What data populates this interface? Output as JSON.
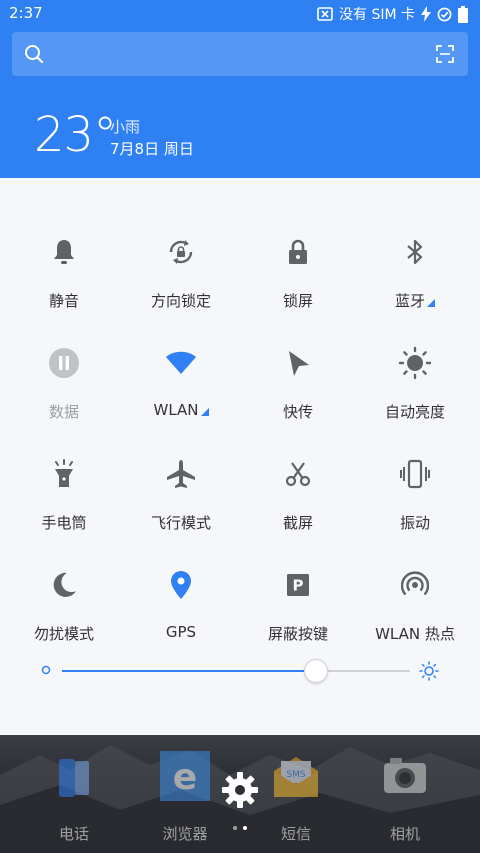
{
  "status": {
    "time": "2:37",
    "carrier_text": "没有 SIM 卡"
  },
  "weather": {
    "temperature": "23°",
    "condition": "小雨",
    "date": "7月8日 周日"
  },
  "toggles": [
    {
      "label": "静音",
      "icon": "bell-icon",
      "active": false
    },
    {
      "label": "方向锁定",
      "icon": "rotation-lock-icon",
      "active": false
    },
    {
      "label": "锁屏",
      "icon": "lock-icon",
      "active": false
    },
    {
      "label": "蓝牙",
      "icon": "bluetooth-icon",
      "active": false
    },
    {
      "label": "数据",
      "icon": "pause-data-icon",
      "active": false,
      "disabled": true
    },
    {
      "label": "WLAN",
      "icon": "wifi-icon",
      "active": true
    },
    {
      "label": "快传",
      "icon": "send-arrow-icon",
      "active": false
    },
    {
      "label": "自动亮度",
      "icon": "brightness-auto-icon",
      "active": false
    },
    {
      "label": "手电筒",
      "icon": "flashlight-icon",
      "active": false
    },
    {
      "label": "飞行模式",
      "icon": "airplane-icon",
      "active": false
    },
    {
      "label": "截屏",
      "icon": "scissors-icon",
      "active": false
    },
    {
      "label": "振动",
      "icon": "vibrate-icon",
      "active": false
    },
    {
      "label": "勿扰模式",
      "icon": "moon-icon",
      "active": false
    },
    {
      "label": "GPS",
      "icon": "location-pin-icon",
      "active": true
    },
    {
      "label": "屏蔽按键",
      "icon": "parking-key-icon",
      "active": false
    },
    {
      "label": "WLAN 热点",
      "icon": "hotspot-icon",
      "active": false
    }
  ],
  "brightness": {
    "level": 0.73
  },
  "dock": {
    "apps": [
      {
        "label": "电话",
        "icon": "phone-app-icon"
      },
      {
        "label": "浏览器",
        "icon": "browser-app-icon"
      },
      {
        "label": "短信",
        "icon": "sms-app-icon"
      },
      {
        "label": "相机",
        "icon": "camera-app-icon"
      }
    ]
  },
  "colors": {
    "accent": "#2f80f3",
    "icon_gray": "#5f6368",
    "panel_bg": "#f6f7fa"
  }
}
